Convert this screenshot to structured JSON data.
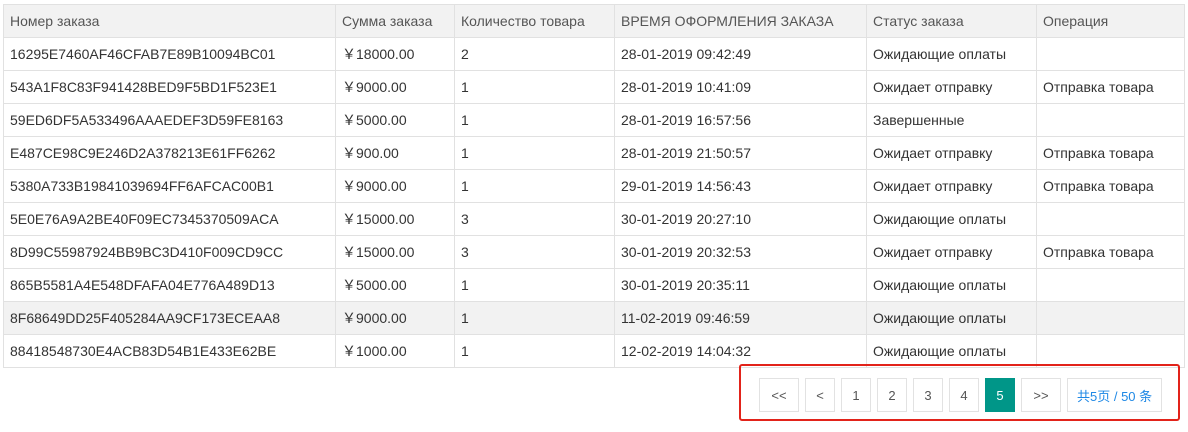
{
  "table": {
    "headers": [
      "Номер заказа",
      "Сумма заказа",
      "Количество товара",
      "ВРЕМЯ ОФОРМЛЕНИЯ ЗАКАЗА",
      "Статус заказа",
      "Операция"
    ],
    "rows": [
      {
        "id": "16295E7460AF46CFAB7E89B10094BC01",
        "amount": "￥18000.00",
        "qty": "2",
        "time": "28-01-2019 09:42:49",
        "status": "Ожидающие оплаты",
        "op": ""
      },
      {
        "id": "543A1F8C83F941428BED9F5BD1F523E1",
        "amount": "￥9000.00",
        "qty": "1",
        "time": "28-01-2019 10:41:09",
        "status": "Ожидает отправку",
        "op": "Отправка товара"
      },
      {
        "id": "59ED6DF5A533496AAAEDEF3D59FE8163",
        "amount": "￥5000.00",
        "qty": "1",
        "time": "28-01-2019 16:57:56",
        "status": "Завершенные",
        "op": ""
      },
      {
        "id": "E487CE98C9E246D2A378213E61FF6262",
        "amount": "￥900.00",
        "qty": "1",
        "time": "28-01-2019 21:50:57",
        "status": "Ожидает отправку",
        "op": "Отправка товара"
      },
      {
        "id": "5380A733B19841039694FF6AFCAC00B1",
        "amount": "￥9000.00",
        "qty": "1",
        "time": "29-01-2019 14:56:43",
        "status": "Ожидает отправку",
        "op": "Отправка товара"
      },
      {
        "id": "5E0E76A9A2BE40F09EC7345370509ACA",
        "amount": "￥15000.00",
        "qty": "3",
        "time": "30-01-2019 20:27:10",
        "status": "Ожидающие оплаты",
        "op": ""
      },
      {
        "id": "8D99C55987924BB9BC3D410F009CD9CC",
        "amount": "￥15000.00",
        "qty": "3",
        "time": "30-01-2019 20:32:53",
        "status": "Ожидает отправку",
        "op": "Отправка товара"
      },
      {
        "id": "865B5581A4E548DFAFA04E776A489D13",
        "amount": "￥5000.00",
        "qty": "1",
        "time": "30-01-2019 20:35:11",
        "status": "Ожидающие оплаты",
        "op": ""
      },
      {
        "id": "8F68649DD25F405284AA9CF173ECEAA8",
        "amount": "￥9000.00",
        "qty": "1",
        "time": "11-02-2019 09:46:59",
        "status": "Ожидающие оплаты",
        "op": ""
      },
      {
        "id": "88418548730E4ACB83D54B1E433E62BE",
        "amount": "￥1000.00",
        "qty": "1",
        "time": "12-02-2019 14:04:32",
        "status": "Ожидающие оплаты",
        "op": ""
      }
    ]
  },
  "pagination": {
    "first_label": "<<",
    "prev_label": "<",
    "pages": [
      "1",
      "2",
      "3",
      "4",
      "5"
    ],
    "current_page": "5",
    "next_label": ">>",
    "total_label": "共5页 / 50 条"
  },
  "colors": {
    "active_page": "#009688",
    "highlight_border": "#e2231a",
    "total_text": "#1e88e5"
  }
}
